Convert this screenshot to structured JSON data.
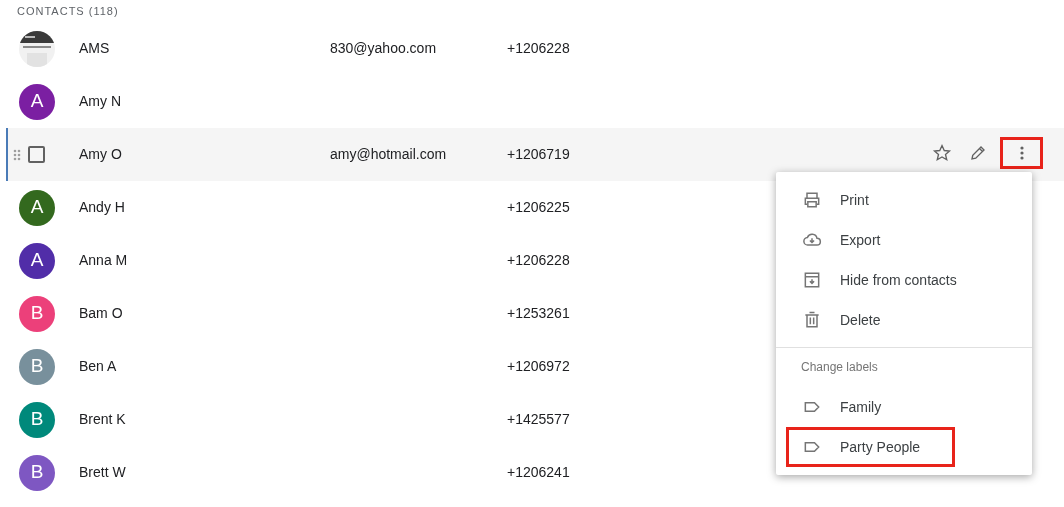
{
  "heading": "CONTACTS (118)",
  "contacts": [
    {
      "name": "AMS",
      "email": "830@yahoo.com",
      "phone": "+1206228",
      "hovered": false
    },
    {
      "name": "Amy N",
      "avatar": {
        "kind": "letter",
        "letter": "A",
        "color": "#7b1fa2"
      },
      "hovered": false
    },
    {
      "name": "Amy O",
      "email": "amy@hotmail.com",
      "phone": "+1206719",
      "hovered": true,
      "checked": false,
      "starred": false
    },
    {
      "name": "Andy H",
      "phone": "+1206225",
      "avatar": {
        "kind": "letter",
        "letter": "A",
        "color": "#33691e"
      },
      "hovered": false
    },
    {
      "name": "Anna M",
      "phone": "+1206228",
      "avatar": {
        "kind": "letter",
        "letter": "A",
        "color": "#512da8"
      },
      "hovered": false
    },
    {
      "name": "Bam O",
      "phone": "+1253261",
      "avatar": {
        "kind": "letter",
        "letter": "B",
        "color": "#ec407a"
      },
      "hovered": false
    },
    {
      "name": "Ben A",
      "phone": "+1206972",
      "avatar": {
        "kind": "letter",
        "letter": "B",
        "color": "#78909c"
      },
      "hovered": false
    },
    {
      "name": "Brent K",
      "phone": "+1425577",
      "avatar": {
        "kind": "letter",
        "letter": "B",
        "color": "#00897b"
      },
      "hovered": false
    },
    {
      "name": "Brett W",
      "phone": "+1206241",
      "avatar": {
        "kind": "letter",
        "letter": "B",
        "color": "#7e57c2"
      },
      "hovered": false
    }
  ],
  "more_button": {
    "highlighted": true
  },
  "menu": [
    {
      "kind": "action",
      "label": "Print",
      "highlighted": false
    },
    {
      "kind": "action",
      "label": "Export",
      "highlighted": false
    },
    {
      "kind": "action",
      "label": "Hide from contacts",
      "highlighted": false
    },
    {
      "kind": "action",
      "label": "Delete",
      "highlighted": false
    },
    {
      "kind": "divider"
    },
    {
      "kind": "header",
      "label": "Change labels"
    },
    {
      "kind": "label",
      "label": "Family",
      "highlighted": false
    },
    {
      "kind": "label",
      "label": "Party People",
      "highlighted": true
    }
  ]
}
